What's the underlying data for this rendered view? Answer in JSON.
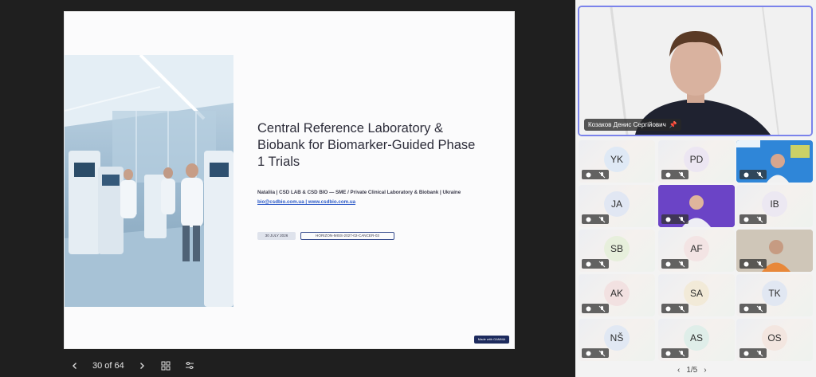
{
  "slide": {
    "title": "Central Reference Laboratory &\nBiobank for Biomarker-Guided Phase\n1 Trials",
    "subtitle": "Nataliia | CSD LAB & CSD BIO — SME / Private Clinical Laboratory & Biobank | Ukraine",
    "links": "bio@csdbio.com.ua | www.csdbio.com.ua",
    "date": "30 JULY 2026",
    "code": "HORIZON-MISS-2027-02-CANCER-03",
    "badge": "Made with GAMMA"
  },
  "navigation": {
    "counter": "30 of 64",
    "prev_icon": "chevron-left-icon",
    "next_icon": "chevron-right-icon",
    "grid_icon": "grid-icon",
    "settings_icon": "sliders-icon"
  },
  "speaker": {
    "name": "Козаков Денис Сергійович"
  },
  "participants": [
    {
      "initials": "YK",
      "color": "#dfe9f5"
    },
    {
      "initials": "PD",
      "color": "#ece6f2"
    },
    {
      "initials": "",
      "color": "#2d7fd6",
      "video": "horizon"
    },
    {
      "initials": "JA",
      "color": "#e1e7f3"
    },
    {
      "initials": "",
      "color": "#5a3bb5",
      "video": "man-purple"
    },
    {
      "initials": "IB",
      "color": "#ece8f2"
    },
    {
      "initials": "SB",
      "color": "#e7efdc"
    },
    {
      "initials": "AF",
      "color": "#f3e4e4"
    },
    {
      "initials": "",
      "color": "#b9b2a6",
      "video": "man-room"
    },
    {
      "initials": "AK",
      "color": "#f2e1e1"
    },
    {
      "initials": "SA",
      "color": "#f2ead8"
    },
    {
      "initials": "TK",
      "color": "#e1e7f2"
    },
    {
      "initials": "NŠ",
      "color": "#e1e8f3"
    },
    {
      "initials": "AS",
      "color": "#dfeee9"
    },
    {
      "initials": "OS",
      "color": "#f3e6e0"
    }
  ],
  "pager": {
    "text": "1/5"
  }
}
